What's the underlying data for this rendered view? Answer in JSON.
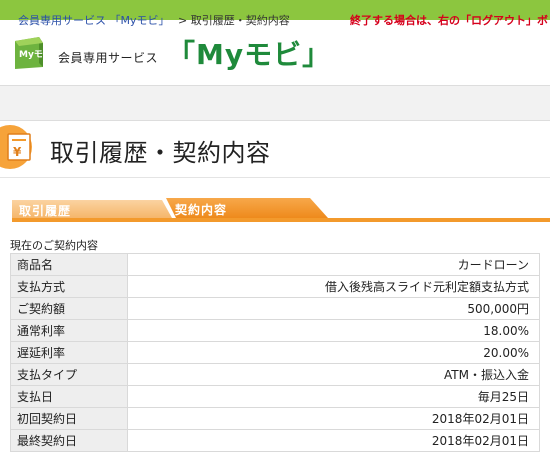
{
  "header": {
    "logo_text": "Myモビ",
    "brand_subtitle": "会員専用サービス",
    "brand_name": "「Myモビ」"
  },
  "breadcrumb": {
    "home": "会員専用サービス 「Myモビ」",
    "current": "> 取引履歴・契約内容",
    "notice": "終了する場合は、右の「ログアウト」ボ"
  },
  "page": {
    "title": "取引履歴・契約内容"
  },
  "tabs": [
    {
      "label": "取引履歴"
    },
    {
      "label": "契約内容"
    }
  ],
  "section": {
    "title": "現在のご契約内容"
  },
  "contract_rows": [
    {
      "label": "商品名",
      "value": "カードローン"
    },
    {
      "label": "支払方式",
      "value": "借入後残高スライド元利定額支払方式"
    },
    {
      "label": "ご契約額",
      "value": "500,000円"
    },
    {
      "label": "通常利率",
      "value": "18.00%"
    },
    {
      "label": "遅延利率",
      "value": "20.00%"
    },
    {
      "label": "支払タイプ",
      "value": "ATM・振込入金"
    },
    {
      "label": "支払日",
      "value": "毎月25日"
    },
    {
      "label": "初回契約日",
      "value": "2018年02月01日"
    },
    {
      "label": "最終契約日",
      "value": "2018年02月01日"
    }
  ],
  "colors": {
    "top_bar": "#8cc63f",
    "brand_green": "#1f8a3b",
    "tab_orange": "#f39a2c",
    "notice_red": "#d6001c"
  }
}
